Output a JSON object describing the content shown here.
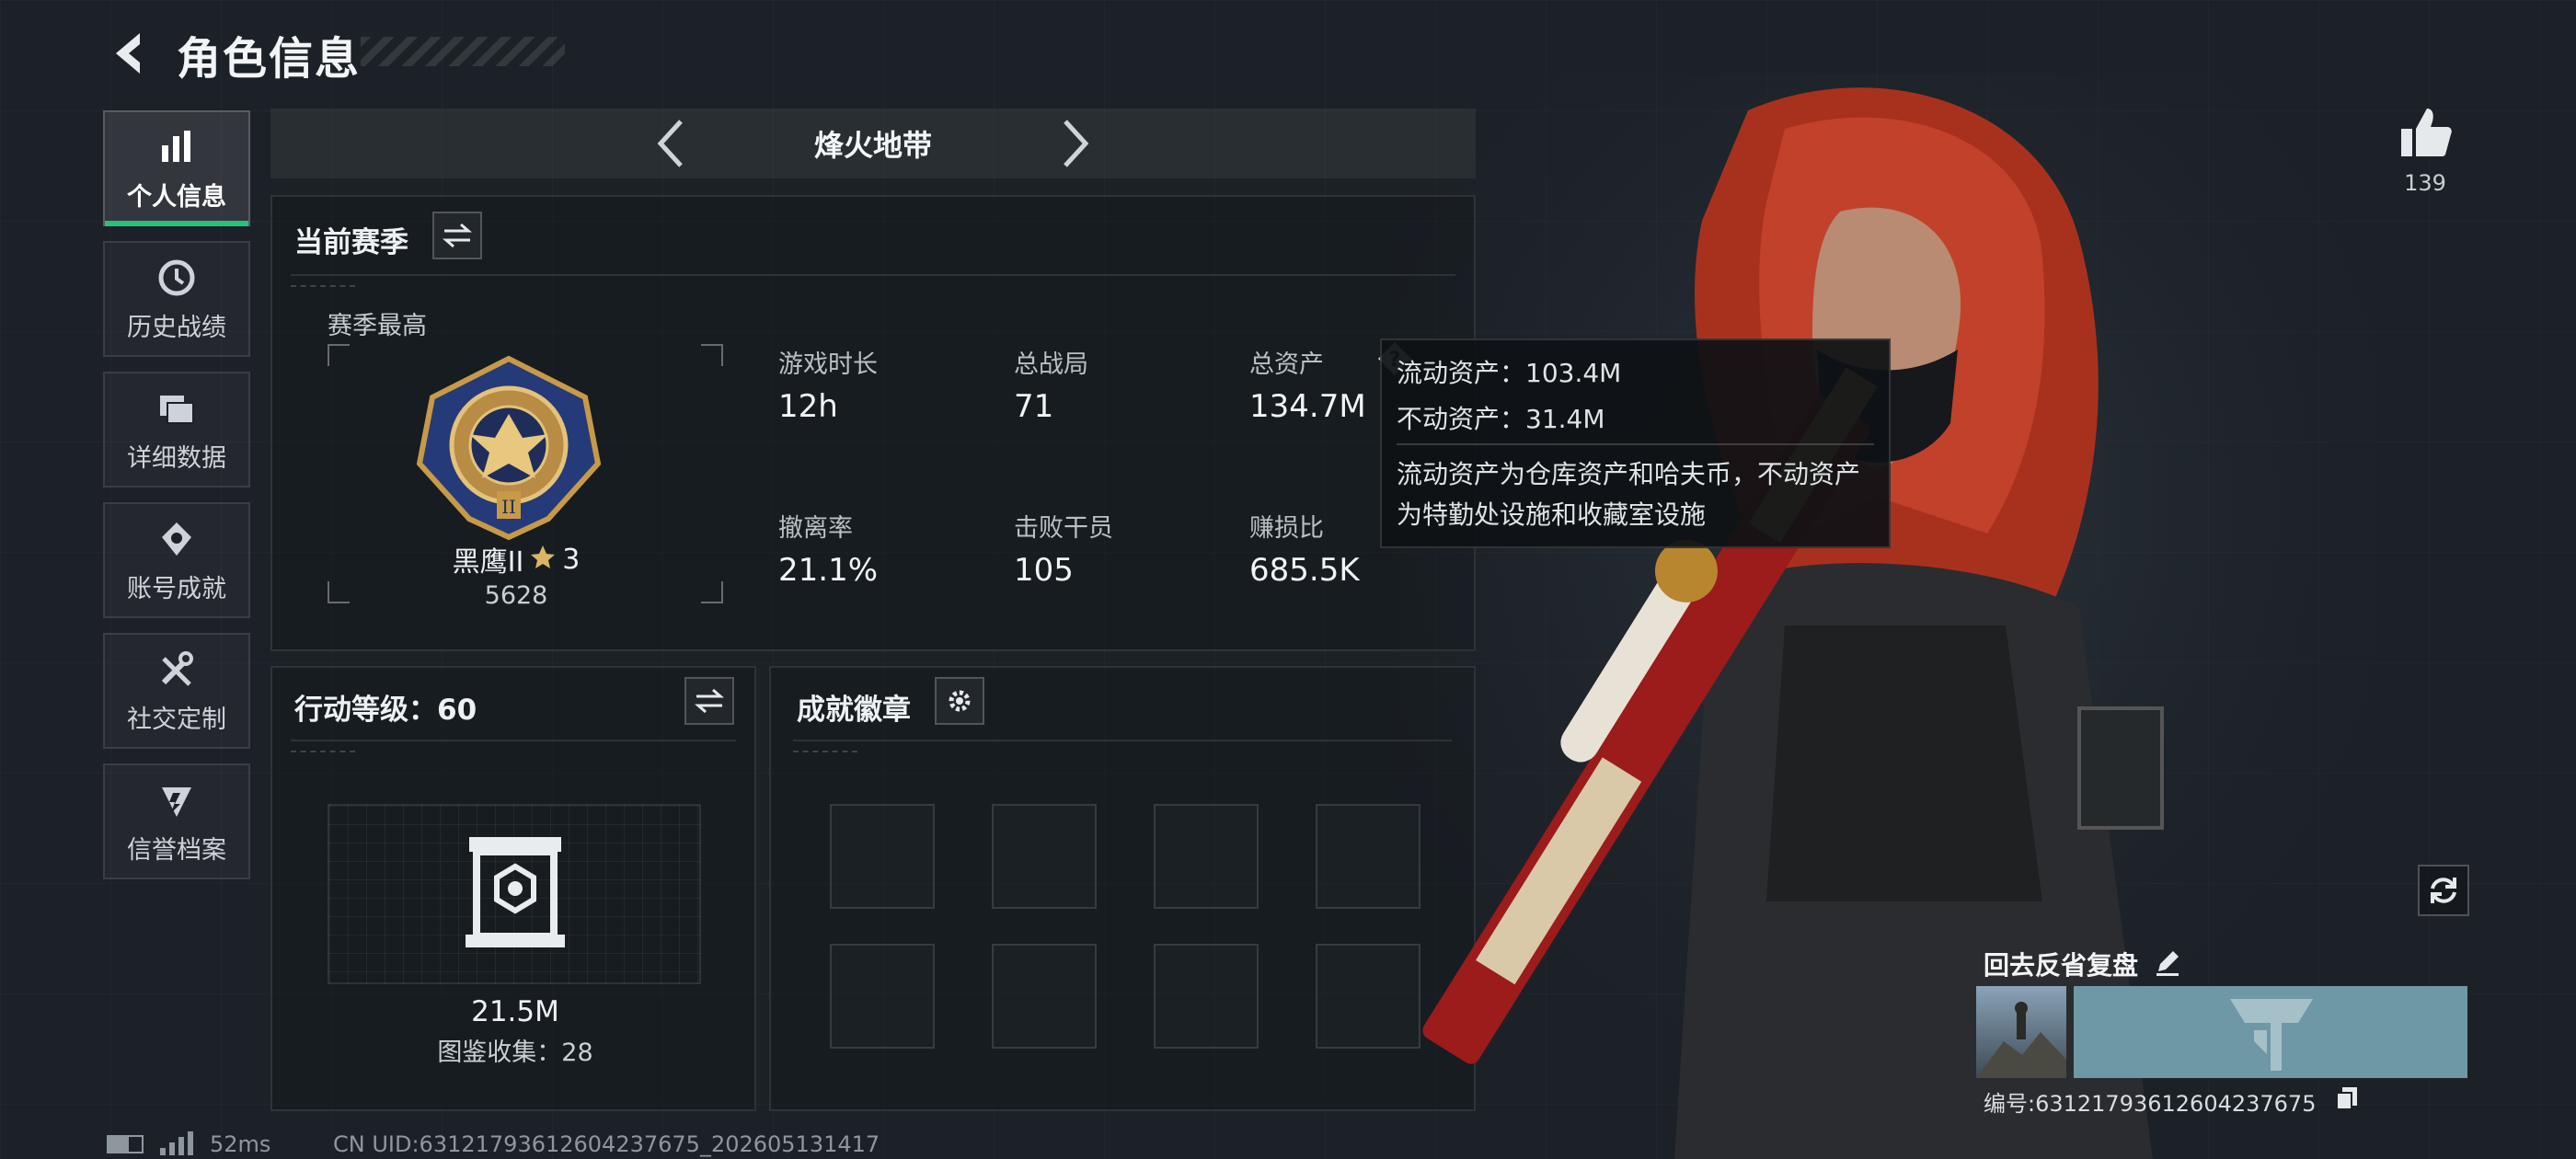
{
  "header": {
    "title": "角色信息"
  },
  "sidebar": {
    "items": [
      {
        "label": "个人信息",
        "icon": "bar-chart-icon",
        "active": true
      },
      {
        "label": "历史战绩",
        "icon": "clock-icon",
        "active": false
      },
      {
        "label": "详细数据",
        "icon": "folders-icon",
        "active": false
      },
      {
        "label": "账号成就",
        "icon": "achievement-icon",
        "active": false
      },
      {
        "label": "社交定制",
        "icon": "tools-icon",
        "active": false
      },
      {
        "label": "信誉档案",
        "icon": "credit-shield-icon",
        "active": false
      }
    ]
  },
  "mode": {
    "title": "烽火地带"
  },
  "season": {
    "title": "当前赛季",
    "best_label": "赛季最高",
    "rank_name": "黑鹰II",
    "rank_stars": "3",
    "rank_score": "5628",
    "stats": [
      {
        "label": "游戏时长",
        "value": "12h"
      },
      {
        "label": "总战局",
        "value": "71"
      },
      {
        "label": "总资产",
        "value": "134.7M"
      },
      {
        "label": "撤离率",
        "value": "21.1%"
      },
      {
        "label": "击败干员",
        "value": "105"
      },
      {
        "label": "赚损比",
        "value": "685.5K"
      }
    ]
  },
  "tooltip": {
    "liquid": "流动资产：103.4M",
    "fixed": "不动资产：31.4M",
    "desc_line1": "流动资产为仓库资产和哈夫币，不动资产",
    "desc_line2": "为特勤处设施和收藏室设施"
  },
  "action_level": {
    "title": "行动等级：60",
    "value": "21.5M",
    "collection": "图鉴收集：28"
  },
  "badges": {
    "title": "成就徽章"
  },
  "likes": {
    "count": "139"
  },
  "replay": {
    "title": "回去反省复盘",
    "id_label": "编号:6312179361260423767​5"
  },
  "footer": {
    "ping": "52ms",
    "uid": "CN UID:63121793612604237675_202605131417"
  },
  "colors": {
    "accent": "#27c27a",
    "panel_border": "#3a4047"
  }
}
